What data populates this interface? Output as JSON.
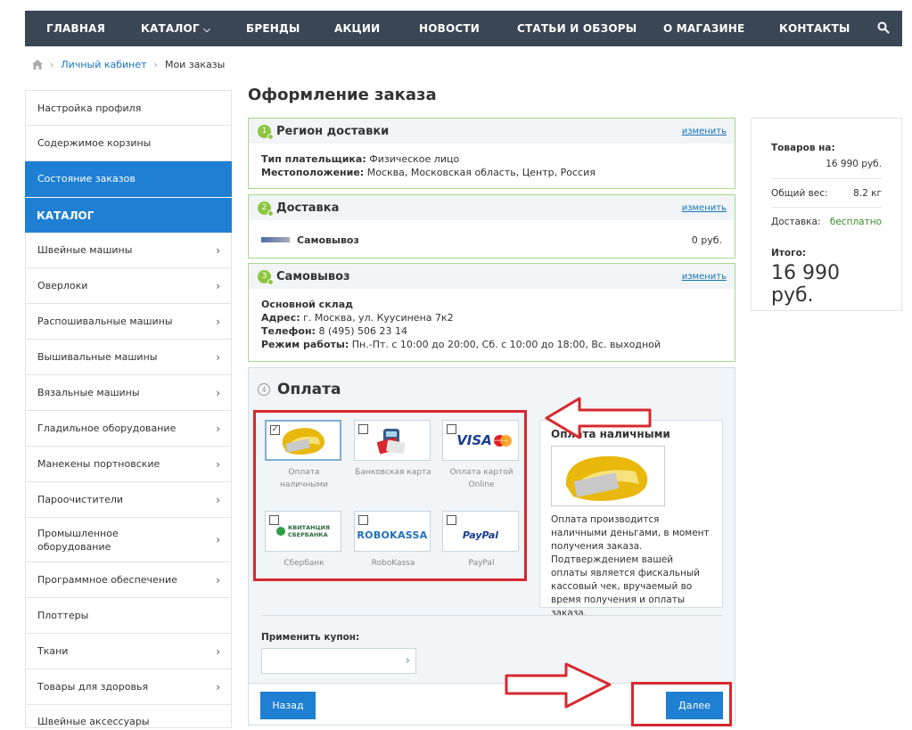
{
  "nav": {
    "items": [
      "ГЛАВНАЯ",
      "КАТАЛОГ",
      "БРЕНДЫ",
      "АКЦИИ",
      "НОВОСТИ",
      "СТАТЬИ И ОБЗОРЫ",
      "О МАГАЗИНЕ",
      "КОНТАКТЫ"
    ],
    "catalog_caret": "⌵"
  },
  "breadcrumb": {
    "sep": "›",
    "items": [
      "Личный кабинет",
      "Мои заказы"
    ]
  },
  "sidebar": {
    "account_items": [
      "Настройка профиля",
      "Содержимое корзины",
      "Состояние заказов"
    ],
    "catalog_header": "КАТАЛОГ",
    "catalog_items": [
      "Швейные машины",
      "Оверлоки",
      "Распошивальные машины",
      "Вышивальные машины",
      "Вязальные машины",
      "Гладильное оборудование",
      "Манекены портновские",
      "Пароочистители",
      "Промышленное оборудование",
      "Программное обеспечение",
      "Плоттеры",
      "Ткани",
      "Товары для здоровья",
      "Швейные аксессуары"
    ],
    "chevron": "›"
  },
  "page_title": "Оформление заказа",
  "region": {
    "num": "1",
    "title": "Регион доставки",
    "change": "изменить",
    "payer_label": "Тип плательщика:",
    "payer_value": "Физическое лицо",
    "location_label": "Местоположение:",
    "location_value": "Москва, Московская область, Центр, Россия"
  },
  "delivery": {
    "num": "2",
    "title": "Доставка",
    "change": "изменить",
    "name": "Самовывоз",
    "price": "0 руб."
  },
  "pickup": {
    "num": "3",
    "title": "Самовывоз",
    "change": "изменить",
    "warehouse": "Основной склад",
    "address_label": "Адрес:",
    "address_value": "г. Москва, ул. Куусинена 7к2",
    "phone_label": "Телефон:",
    "phone_value": "8 (495) 506 23 14",
    "hours_label": "Режим работы:",
    "hours_value": "Пн.-Пт. с 10:00 до 20:00, Сб. с 10:00 до 18:00, Вс. выходной"
  },
  "payment": {
    "num": "4",
    "title": "Оплата",
    "methods": [
      {
        "line1": "Оплата",
        "line2": "наличными",
        "checked": true
      },
      {
        "line1": "Банковская карта",
        "line2": "",
        "checked": false
      },
      {
        "line1": "Оплата картой",
        "line2": "Online",
        "checked": false
      },
      {
        "line1": "Сбербанк",
        "line2": "",
        "checked": false
      },
      {
        "line1": "RoboKassa",
        "line2": "",
        "checked": false
      },
      {
        "line1": "PayPal",
        "line2": "",
        "checked": false
      }
    ],
    "checkmark": "✓",
    "logos": {
      "visa": "VISA",
      "mastercard": "MasterCard",
      "sber1": "КВИТАНЦИЯ",
      "sber2": "СБЕРБАНКА",
      "robokassa": "ROBOKASSA",
      "paypal": "PayPal"
    },
    "detail_title": "Оплата наличными",
    "detail_text": "Оплата производится наличными деньгами, в момент получения заказа. Подтверждением вашей оплаты является фискальный кассовый чек, вручаемый во время получения и оплаты заказа.",
    "coupon_label": "Применить купон:",
    "coupon_placeholder": "",
    "coupon_go": "›",
    "back": "Назад",
    "next": "Далее"
  },
  "summary": {
    "goods_label": "Товаров на:",
    "goods_value": "16 990 руб.",
    "weight_label": "Общий вес:",
    "weight_value": "8.2 кг",
    "delivery_label": "Доставка:",
    "delivery_value": "бесплатно",
    "total_label": "Итого:",
    "total_value": "16 990 руб."
  },
  "colors": {
    "nav_bg": "#3a4654",
    "accent": "#1e7fd3",
    "annotation_red": "#d7282f",
    "section_border": "#a9d98b",
    "free_green": "#3a8a2a"
  }
}
